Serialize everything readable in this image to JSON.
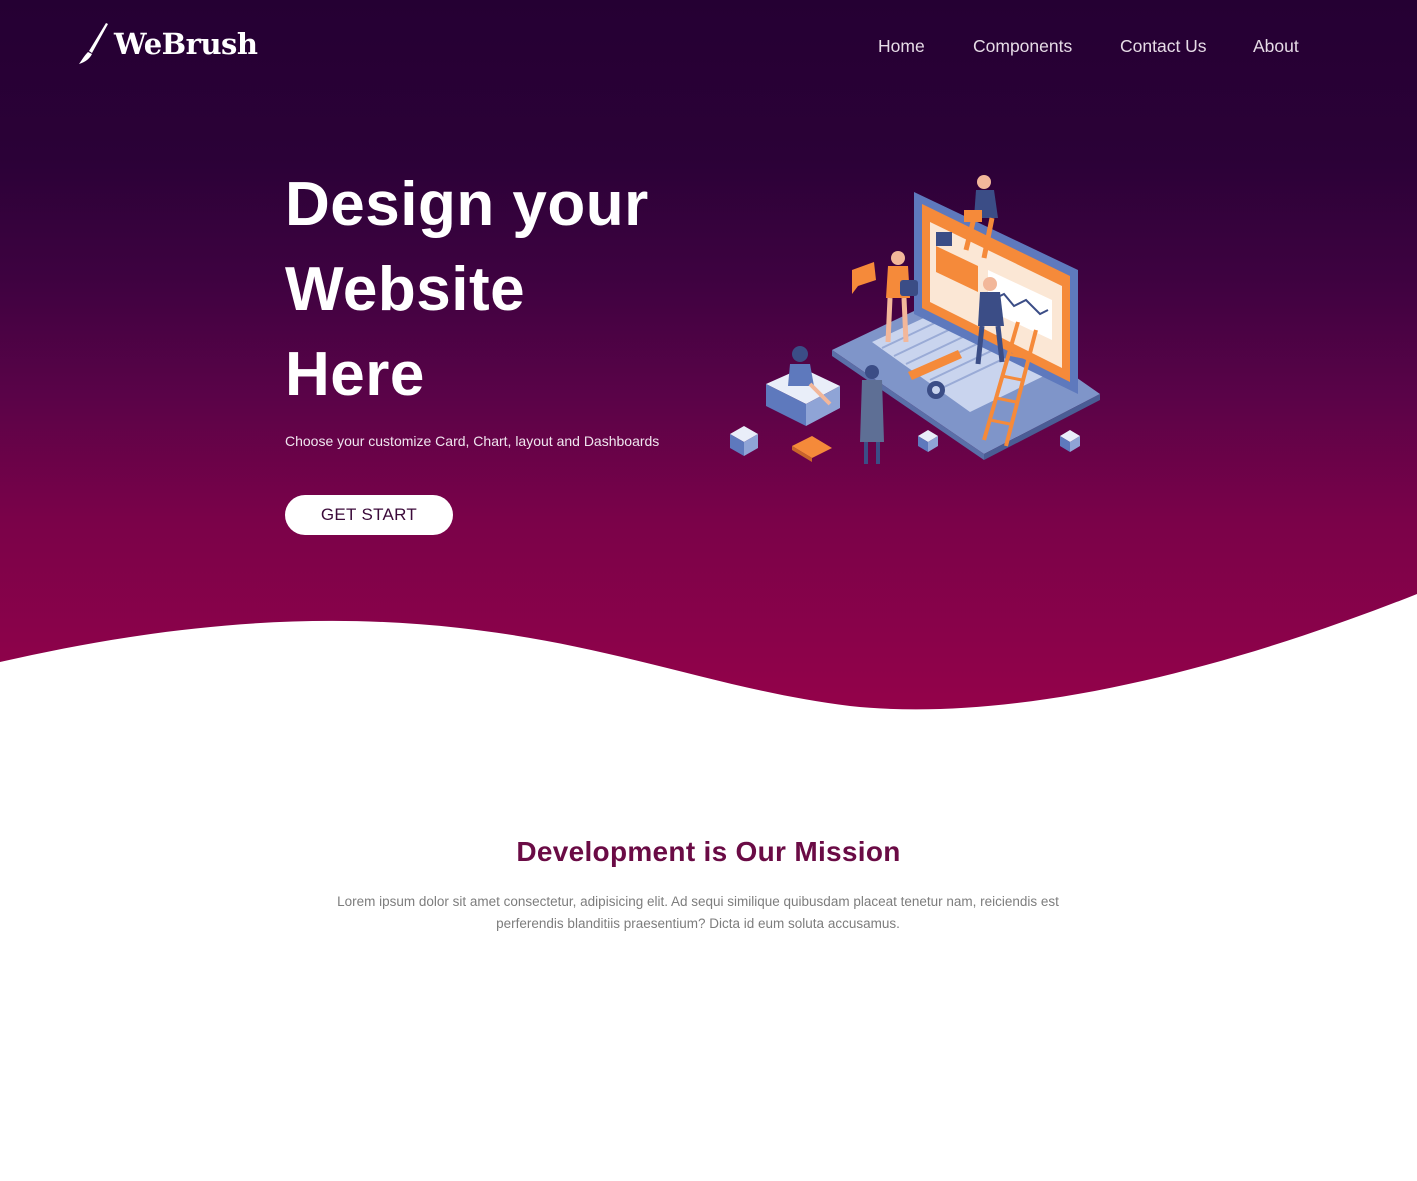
{
  "brand": {
    "name": "WeBrush",
    "icon": "paintbrush-icon"
  },
  "nav": {
    "items": [
      {
        "label": "Home"
      },
      {
        "label": "Components"
      },
      {
        "label": "Contact Us"
      },
      {
        "label": "About"
      }
    ]
  },
  "hero": {
    "headline_lines": [
      "Design your",
      "Website",
      "Here"
    ],
    "subtitle": "Choose your customize Card, Chart, layout and Dashboards",
    "cta_label": "GET START",
    "illustration": "isometric-laptop-team-illustration"
  },
  "mission": {
    "title": "Development is Our Mission",
    "text_lines": [
      "Lorem ipsum dolor sit amet consectetur, adipisicing elit. Ad sequi similique quibusdam placeat tenetur nam, reiciendis est",
      "perferendis blanditiis praesentium? Dicta id eum soluta accusamus."
    ]
  },
  "colors": {
    "hero_top": "#250033",
    "hero_bottom": "#95024a",
    "accent_title": "#6a0b45",
    "illustration_orange": "#f58a3a",
    "illustration_blue": "#6b86c2"
  }
}
